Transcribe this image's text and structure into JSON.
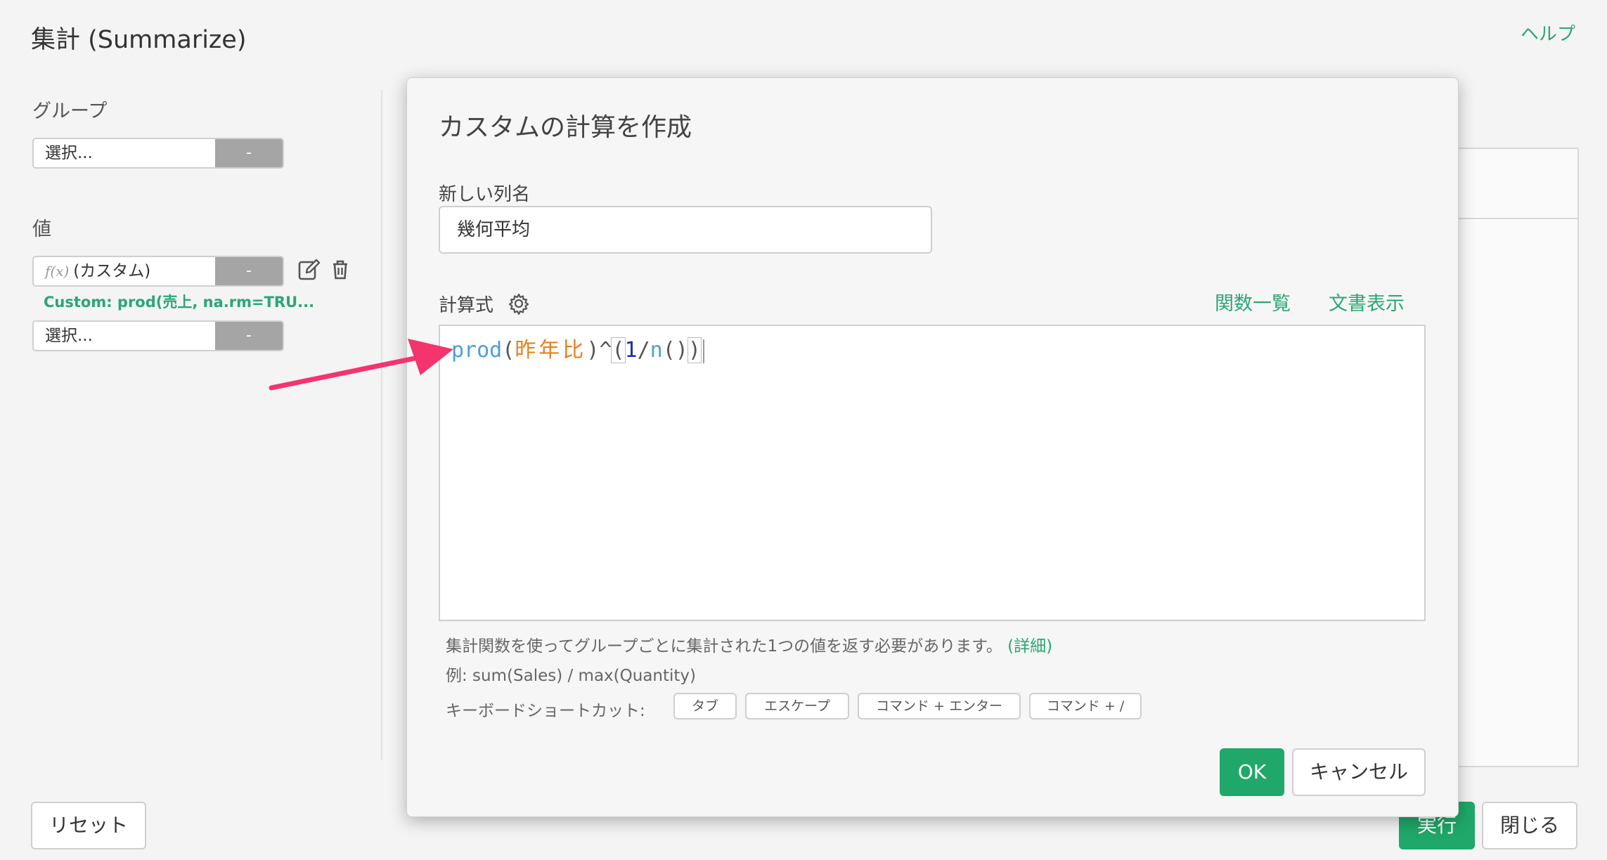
{
  "page": {
    "title": "集計 (Summarize)",
    "help_link": "ヘルプ"
  },
  "sidebar": {
    "group_label": "グループ",
    "group_select_placeholder": "選択...",
    "group_select_button": "-",
    "value_label": "値",
    "value_items": [
      {
        "fx_mark": "f(x)",
        "label": "(カスタム)",
        "button": "-"
      }
    ],
    "custom_expression": "Custom: prod(売上, na.rm=TRU...",
    "value_select_placeholder": "選択...",
    "value_select_button": "-",
    "icons": [
      "edit-icon",
      "trash-icon"
    ]
  },
  "footer": {
    "reset_label": "リセット",
    "run_label": "実行",
    "close_label": "閉じる"
  },
  "modal": {
    "title": "カスタムの計算を作成",
    "new_column_label": "新しい列名",
    "new_column_value": "幾何平均",
    "formula_label": "計算式",
    "function_list_link": "関数一覧",
    "docs_link": "文書表示",
    "code_tokens": {
      "fn": "prod",
      "open1": "(",
      "col": "昨年比",
      "close1": ")",
      "caret": "^",
      "open2": "(",
      "num": "1",
      "slash": "/",
      "fn2": "n",
      "open3": "(",
      "close3": ")",
      "close2": ")"
    },
    "hint_text": "集計関数を使ってグループごとに集計された1つの値を返す必要があります。",
    "hint_link": "(詳細)",
    "example_text": "例: sum(Sales) / max(Quantity)",
    "shortcut_label": "キーボードショートカット:",
    "shortcuts": [
      "タブ",
      "エスケープ",
      "コマンド + エンター",
      "コマンド + /"
    ],
    "ok_label": "OK",
    "cancel_label": "キャンセル"
  },
  "colors": {
    "accent_green": "#1fa869",
    "link_green": "#2aa773",
    "annotation_arrow": "#f5336d"
  }
}
